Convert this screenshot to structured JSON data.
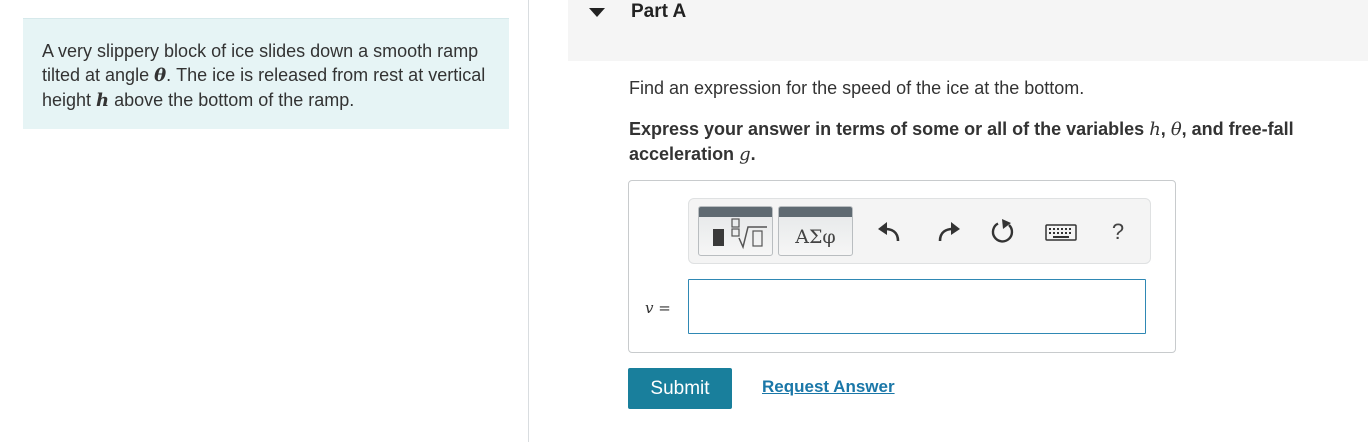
{
  "problem": {
    "text_1": "A very slippery block of ice slides down a smooth ramp tilted at angle ",
    "var_theta": "θ",
    "text_2": ". The ice is released from rest at vertical height ",
    "var_h": "h",
    "text_3": " above the bottom of the ramp."
  },
  "part": {
    "title": "Part A"
  },
  "question": "Find an expression for the speed of the ice at the bottom.",
  "instruction": {
    "text_1": "Express your answer in terms of some or all of the variables ",
    "var_h": "h",
    "sep_1": ", ",
    "var_theta": "θ",
    "text_2": ", and free-fall acceleration ",
    "var_g": "g",
    "text_3": "."
  },
  "toolbar": {
    "greek_label": "ΑΣφ",
    "help_label": "?",
    "icons": [
      "templates-icon",
      "greek-symbols-icon",
      "undo-icon",
      "redo-icon",
      "reset-icon",
      "keyboard-icon",
      "help-icon"
    ]
  },
  "answer": {
    "variable": "v",
    "equals": " =",
    "value": ""
  },
  "buttons": {
    "submit": "Submit",
    "request": "Request Answer"
  },
  "colors": {
    "problem_bg": "#e6f4f5",
    "submit_bg": "#197f9c",
    "link": "#1a77a8",
    "input_border": "#2f88b4"
  }
}
